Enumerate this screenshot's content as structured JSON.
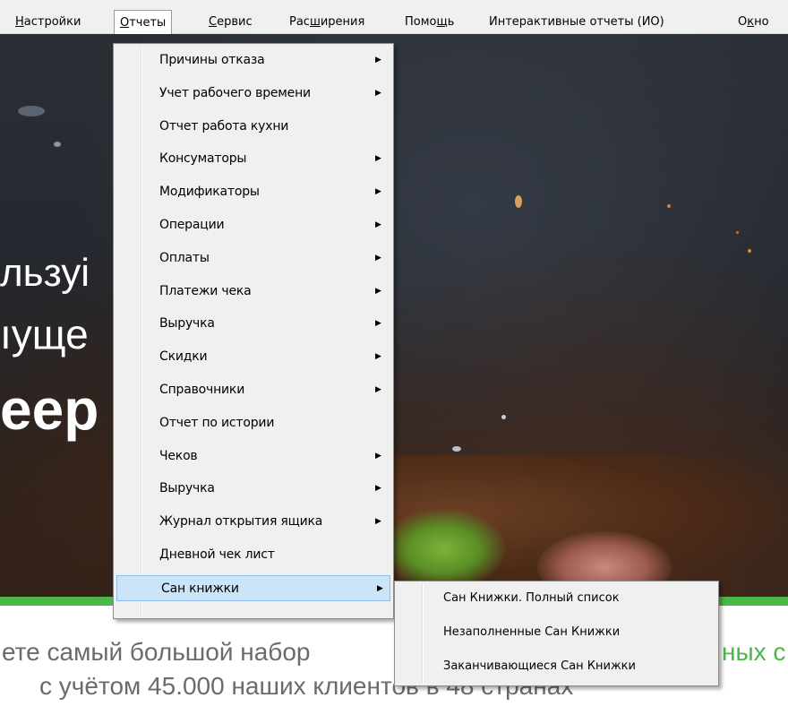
{
  "menubar": {
    "items": [
      {
        "label": "Настройки",
        "accel": "Н",
        "rest": "астройки"
      },
      {
        "label": "Отчеты",
        "accel": "О",
        "rest": "тчеты"
      },
      {
        "label": "Сервис",
        "accel": "С",
        "rest": "ервис"
      },
      {
        "pre": "Рас",
        "accel": "ш",
        "rest": "ирения",
        "label": "Расширения"
      },
      {
        "pre": "Помо",
        "accel": "щ",
        "rest": "ь",
        "label": "Помощь"
      },
      {
        "label": "Интерактивные отчеты (ИО)"
      },
      {
        "pre": "О",
        "accel": "к",
        "rest": "но",
        "label": "Окно"
      }
    ]
  },
  "hero": {
    "line1": "льзуі",
    "line2": "ıуще",
    "line3": "еер"
  },
  "lower": {
    "line1_prefix": "ете самый большой набор",
    "line1_green": "ных с",
    "line2": "с учётом 45.000 наших клиентов в 48 странах"
  },
  "reports_menu": {
    "items": [
      {
        "label": "Причины отказа",
        "submenu": true
      },
      {
        "label": "Учет рабочего времени",
        "submenu": true
      },
      {
        "label": "Отчет работа кухни",
        "submenu": false
      },
      {
        "label": "Консуматоры",
        "submenu": true
      },
      {
        "label": "Модификаторы",
        "submenu": true
      },
      {
        "label": "Операции",
        "submenu": true
      },
      {
        "label": "Оплаты",
        "submenu": true
      },
      {
        "label": "Платежи чека",
        "submenu": true
      },
      {
        "label": "Выручка",
        "submenu": true
      },
      {
        "label": "Скидки",
        "submenu": true
      },
      {
        "label": "Справочники",
        "submenu": true
      },
      {
        "label": "Отчет по истории",
        "submenu": false
      },
      {
        "label": "Чеков",
        "submenu": true
      },
      {
        "label": "Выручка",
        "submenu": true
      },
      {
        "label": "Журнал открытия ящика",
        "submenu": true
      },
      {
        "label": "Дневной чек лист",
        "submenu": false
      },
      {
        "label": "Сан книжки",
        "submenu": true,
        "highlighted": true
      }
    ]
  },
  "san_submenu": {
    "items": [
      {
        "label": "Сан Книжки. Полный список"
      },
      {
        "label": "Незаполненные Сан Книжки"
      },
      {
        "label": "Заканчивающиеся Сан Книжки"
      }
    ]
  },
  "colors": {
    "accent_green": "#4cb648",
    "menu_bg": "#f0f0f0",
    "highlight_bg": "#cce4f7",
    "highlight_border": "#8fbde8"
  },
  "icons": {
    "submenu_arrow": "chevron-right-icon"
  }
}
